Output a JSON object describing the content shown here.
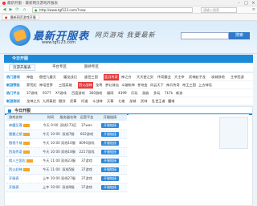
{
  "browser": {
    "title": "最新开服 - 最新网页游戏开服表",
    "address": "http://www.tgf123.com/?new",
    "search_placeholder": "请输入搜索",
    "favorite_tab": "最新网页游戏开服"
  },
  "header": {
    "brand_name": "最新开服表",
    "brand_url": "www.tgf123.com",
    "slogan": "网页游戏 我要最新",
    "search_button": "搜索"
  },
  "nav": {
    "active": "今日开服"
  },
  "subnav": {
    "tabs": [
      "页游开服表",
      "平台专区",
      "期待专区"
    ]
  },
  "tag_rows": [
    {
      "head": "热门游戏",
      "items": [
        "神曲",
        "傲世九重天",
        "屠龙战记",
        "盛世三国",
        "蓝月传奇",
        "神之刃",
        "大天使之剑",
        "传奇霸业",
        "大主宰",
        "武神赵子龙",
        "攻城掠地",
        "主宰西游"
      ]
    },
    {
      "head": "新游预告",
      "items": [
        "莽荒纪",
        "神话世界",
        "三国英雄",
        "烈火战神",
        "龙将",
        "梦幻诛仙",
        "斗破乾坤",
        "苍穹变",
        "风云天下",
        "神兵传奇",
        "帝王三国",
        "上古神话"
      ]
    },
    {
      "head": "热门平台",
      "items": [
        "37游戏",
        "9377",
        "XY游戏",
        "百度游戏",
        "360游戏",
        "顺网",
        "4399",
        "乐玩",
        "游族",
        "多玩",
        "7k7k",
        "新浪"
      ]
    },
    {
      "head": "新游测试",
      "items": [
        "龙神之光",
        "九阴真经",
        "傲剑",
        "武尊",
        "问道",
        "斗战神",
        "天尊",
        "七雄",
        "龙城",
        "武林",
        "乱世王者",
        "魔域"
      ]
    }
  ],
  "panel": {
    "title": "今日开服",
    "columns": [
      "游戏名称",
      "时间",
      "服务器名称",
      "运营平台",
      "开服链接"
    ]
  },
  "rows": [
    {
      "name": "神魔至尊",
      "time": "今天 9:00",
      "server": "双线173区",
      "platform": "37wan",
      "action": "开服链接"
    },
    {
      "name": "雷霆之怒",
      "time": "今天 10:00",
      "server": "双线7服",
      "platform": "602游戏",
      "action": "开服链接"
    },
    {
      "name": "傲视千雄",
      "time": "今天 10:00",
      "server": "双线16服",
      "platform": "8090游戏",
      "action": "开服链接"
    },
    {
      "name": "烈焰传奇",
      "time": "今天 10:00",
      "server": "双线18服",
      "platform": "2217游戏",
      "action": "开服链接"
    },
    {
      "name": "佣人三国志",
      "time": "今天 11:00",
      "server": "双线23服",
      "platform": "37游戏",
      "action": "开服链接"
    },
    {
      "name": "烈火封神",
      "time": "今天 11:00",
      "server": "双线5服",
      "platform": "37游戏",
      "action": "开服链接"
    },
    {
      "name": "开服表",
      "time": "上午 10:00",
      "server": "双线27服",
      "platform": "37游戏",
      "action": "开服链接"
    },
    {
      "name": "开服表",
      "time": "上午 10:00",
      "server": "双线9服",
      "platform": "37游戏",
      "action": "开服链接"
    }
  ]
}
